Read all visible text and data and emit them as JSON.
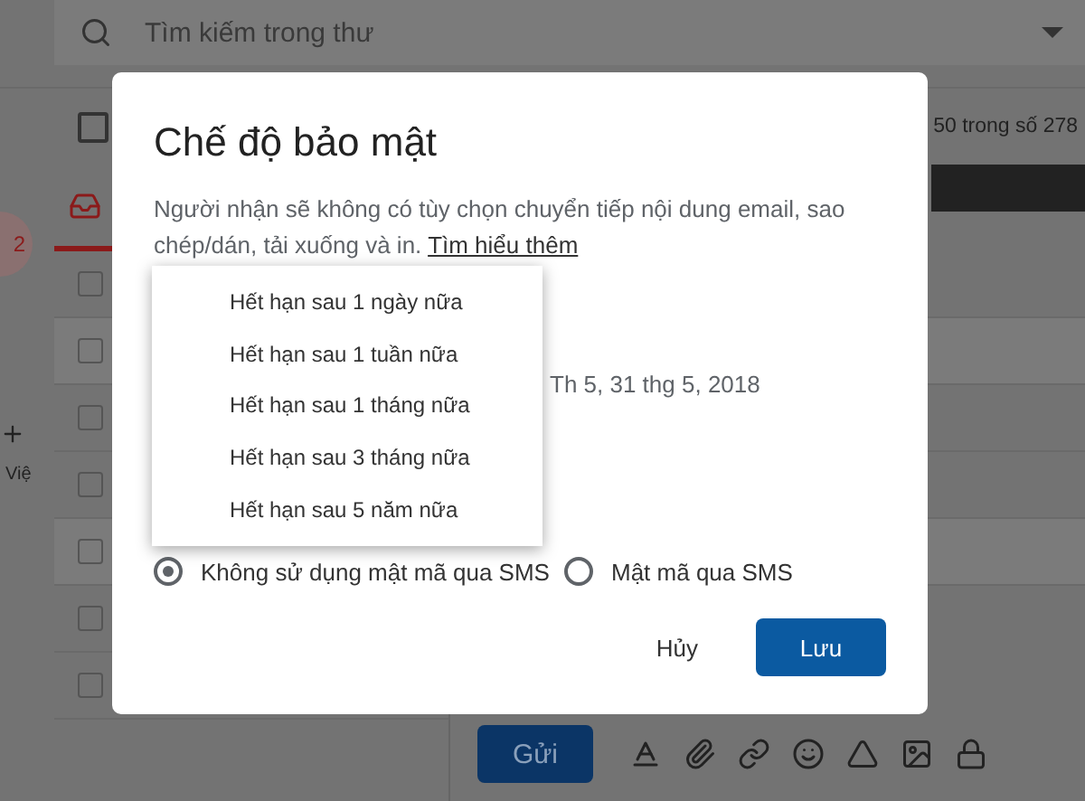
{
  "search": {
    "placeholder": "Tìm kiếm trong thư"
  },
  "sidebar": {
    "badge": "2",
    "items": [
      "Việ"
    ]
  },
  "toolbar": {
    "select_all_checked": false,
    "count": "50 trong số 278"
  },
  "rows": [
    {
      "checked": false
    },
    {
      "checked": false
    },
    {
      "checked": false
    },
    {
      "checked": false
    },
    {
      "checked": false
    },
    {
      "checked": false
    },
    {
      "checked": false
    }
  ],
  "compose": {
    "send": "Gửi"
  },
  "dialog": {
    "title": "Chế độ bảo mật",
    "description": "Người nhận sẽ không có tùy chọn chuyển tiếp nội dung email, sao chép/dán, tải xuống và in.",
    "link": "Tìm hiểu thêm",
    "expiry_date": "Th 5, 31 thg 5, 2018",
    "expiry_menu": [
      "Hết hạn sau 1 ngày nữa",
      "Hết hạn sau 1 tuần nữa",
      "Hết hạn sau 1 tháng nữa",
      "Hết hạn sau 3 tháng nữa",
      "Hết hạn sau 5 năm nữa"
    ],
    "passcode_options": [
      {
        "label": "Không sử dụng mật mã qua SMS",
        "selected": true
      },
      {
        "label": "Mật mã qua SMS",
        "selected": false
      }
    ],
    "buttons": {
      "cancel": "Hủy",
      "save": "Lưu"
    }
  }
}
